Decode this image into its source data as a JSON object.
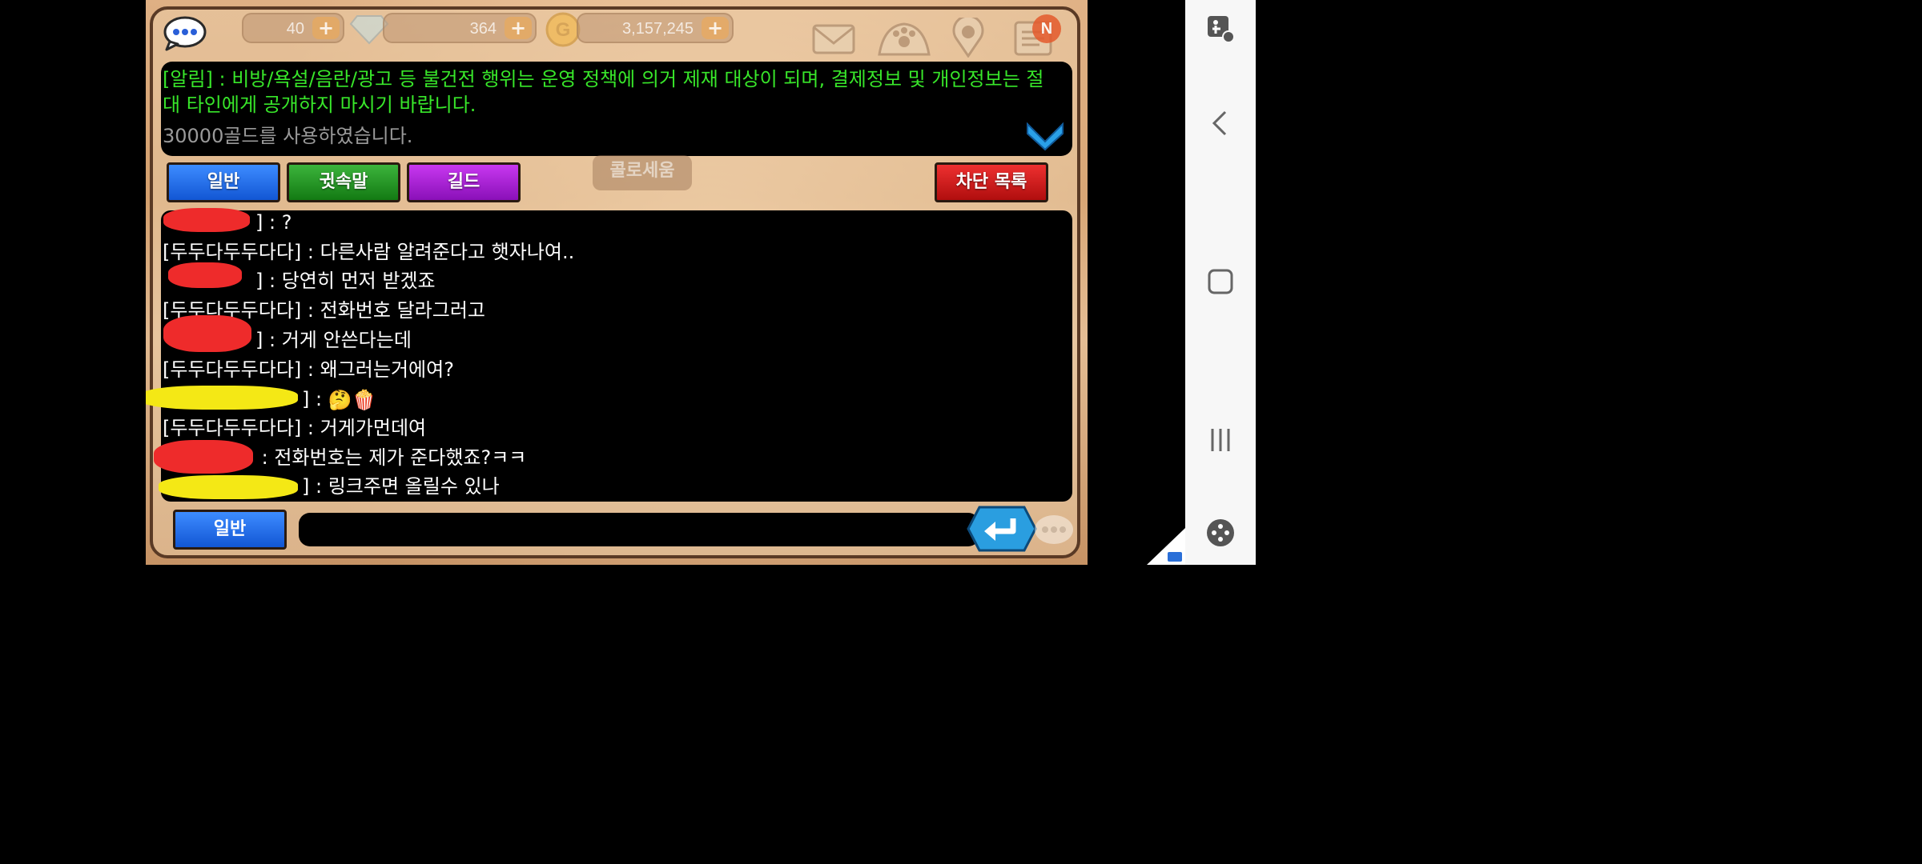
{
  "top_bar": {
    "energy": "40",
    "gems": "364",
    "gold": "3,157,245",
    "plus_label": "+",
    "new_badge": "N"
  },
  "notice": {
    "system_message": "[알림] : 비방/욕설/음란/광고 등 불건전 행위는 운영 정책에 의거 제재 대상이 되며, 결제정보 및 개인정보는 절대 타인에게 공개하지 마시기 바랍니다.",
    "gold_message": "30000골드를 사용하였습니다."
  },
  "tabs": {
    "general": "일반",
    "whisper": "귓속말",
    "guild": "길드",
    "block_list": "차단 목록"
  },
  "background_sign": "콜로세움",
  "messages": [
    {
      "name": "[",
      "suffix": "] : ",
      "text": "?"
    },
    {
      "name": "[두두다두두다다]",
      "suffix": " : ",
      "text": "다른사람 알려준다고 햇자나여.."
    },
    {
      "name": "[",
      "suffix": "] : ",
      "text": "당연히 먼저 받겠죠"
    },
    {
      "name": "[두두다두두다다]",
      "suffix": " : ",
      "text": "전화번호 달라그러고"
    },
    {
      "name": "[",
      "suffix": "] : ",
      "text": "거게 안쓴다는데"
    },
    {
      "name": "[두두다두두다다]",
      "suffix": " : ",
      "text": "왜그러는거에여?"
    },
    {
      "name": "[",
      "suffix": "] : ",
      "text": "🤔🍿"
    },
    {
      "name": "[두두다두두다다]",
      "suffix": " : ",
      "text": "거게가먼데여"
    },
    {
      "name": "[",
      "suffix": " : ",
      "text": "전화번호는 제가 준다했죠?ㅋㅋ"
    },
    {
      "name": "[",
      "suffix": "] : ",
      "text": "링크주면 올릴수 있나"
    }
  ],
  "input": {
    "channel": "일반",
    "value": ""
  },
  "colors": {
    "notice_green": "#38e62a",
    "tab_blue": "#1f6fe8",
    "tab_green": "#1e961e",
    "tab_purple": "#a820d8",
    "tab_red": "#d41c1c",
    "redact_red": "#ee2b2b",
    "redact_yellow": "#f4e815"
  },
  "icons": [
    "chat-bubble-icon",
    "plus-icon",
    "diamond-icon",
    "gold-coin-icon",
    "mail-icon",
    "paw-icon",
    "location-pin-icon",
    "notice-board-icon",
    "chevron-down-icon",
    "enter-icon",
    "accessibility-icon",
    "back-icon",
    "home-icon",
    "recents-icon",
    "game-tools-icon"
  ]
}
